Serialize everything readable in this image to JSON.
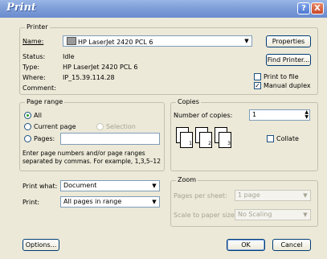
{
  "window": {
    "title": "Print"
  },
  "printer": {
    "group_label": "Printer",
    "name_label": "Name:",
    "name_value": "HP LaserJet 2420 PCL 6",
    "properties": "Properties",
    "status_label": "Status:",
    "status_value": "Idle",
    "type_label": "Type:",
    "type_value": "HP LaserJet 2420 PCL 6",
    "where_label": "Where:",
    "where_value": "IP_15.39.114.28",
    "comment_label": "Comment:",
    "comment_value": "",
    "find_printer": "Find Printer...",
    "print_to_file": "Print to file",
    "print_to_file_checked": false,
    "manual_duplex": "Manual duplex",
    "manual_duplex_checked": true
  },
  "page_range": {
    "group_label": "Page range",
    "all": "All",
    "current_page": "Current page",
    "selection": "Selection",
    "pages": "Pages:",
    "pages_value": "",
    "selected": "all",
    "hint": "Enter page numbers and/or page ranges separated by commas.  For example, 1,3,5–12"
  },
  "copies": {
    "group_label": "Copies",
    "number_label": "Number of copies:",
    "number_value": "1",
    "collate": "Collate",
    "collate_checked": false,
    "page_numbers": [
      "1",
      "2",
      "3",
      "1",
      "2",
      "3"
    ]
  },
  "print_options": {
    "print_what_label": "Print what:",
    "print_what_value": "Document",
    "print_label": "Print:",
    "print_value": "All pages in range"
  },
  "zoom": {
    "group_label": "Zoom",
    "pages_per_sheet_label": "Pages per sheet:",
    "pages_per_sheet_value": "1 page",
    "scale_label": "Scale to paper size:",
    "scale_value": "No Scaling"
  },
  "buttons": {
    "options": "Options...",
    "ok": "OK",
    "cancel": "Cancel"
  },
  "icons": {
    "help": "?",
    "close": "X",
    "dropdown": "▼",
    "spin_up": "▲",
    "spin_down": "▼",
    "check": "✓"
  }
}
